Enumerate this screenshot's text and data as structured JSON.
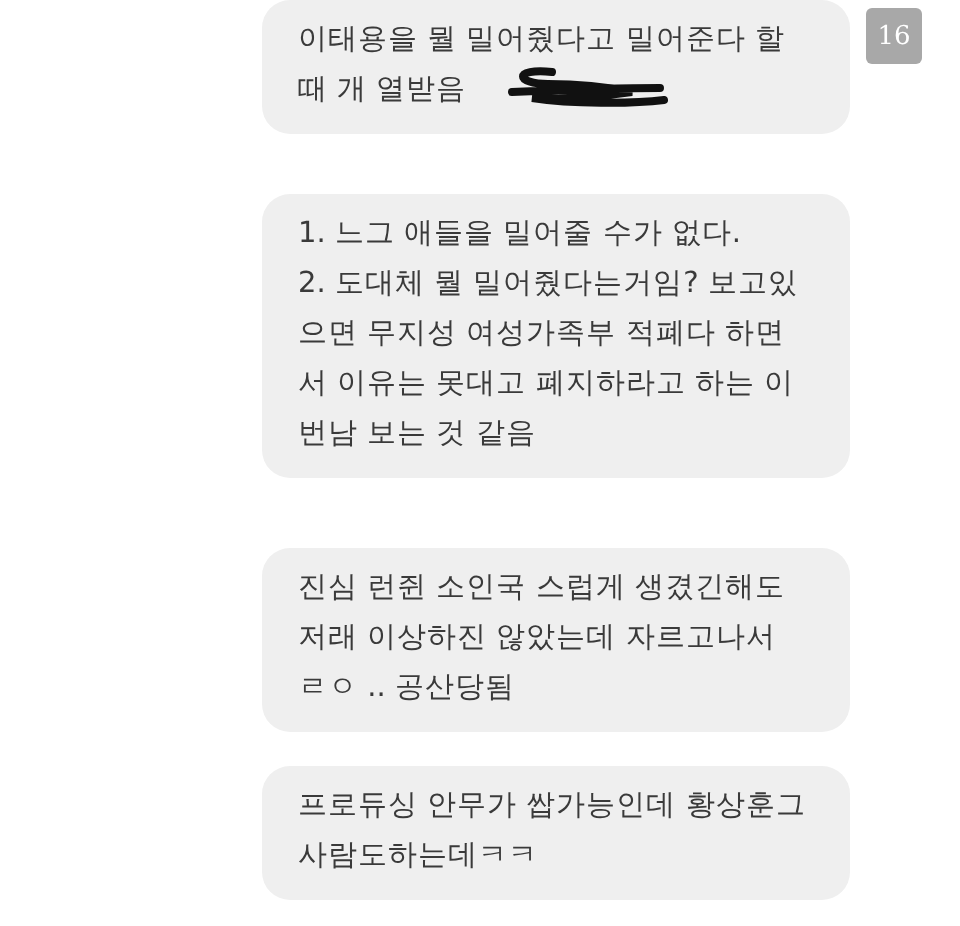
{
  "messages": [
    {
      "text": "이태용을 뭘 밀어줬다고 밀어준다 할\n때 개 열받음",
      "scribbled": true,
      "badge": "16"
    },
    {
      "text": "1. 느그 애들을 밀어줄 수가 없다.\n2. 도대체 뭘 밀어줬다는거임? 보고있\n으면 무지성 여성가족부 적폐다 하면\n서 이유는 못대고 폐지하라고 하는 이\n번남 보는 것 같음",
      "scribbled": false
    },
    {
      "text": "진심 런쥔 소인국 스럽게 생겼긴해도\n저래 이상하진 않았는데 자르고나서\nㄹㅇ .. 공산당됨",
      "scribbled": false
    },
    {
      "text": "프로듀싱 안무가 쌉가능인데 황상훈그\n사람도하는데ㅋㅋ",
      "scribbled": false
    }
  ]
}
